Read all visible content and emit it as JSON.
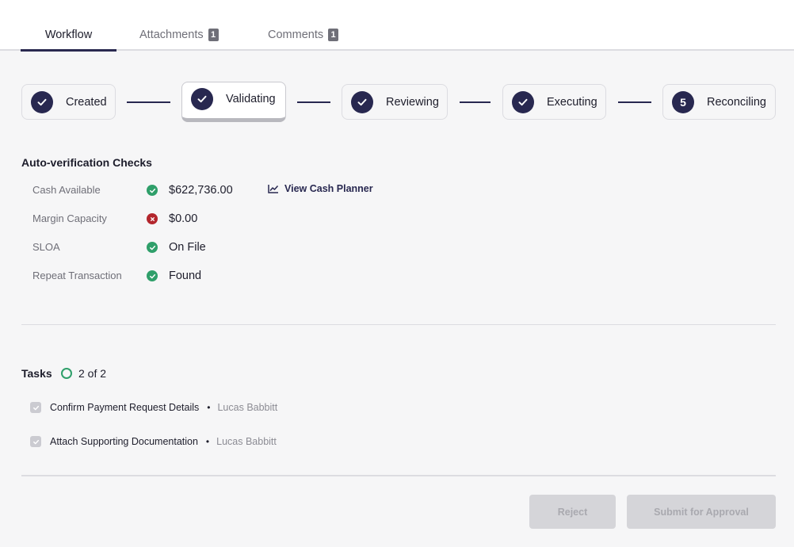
{
  "tabs": [
    {
      "label": "Workflow",
      "count": ""
    },
    {
      "label": "Attachments",
      "count": "1"
    },
    {
      "label": "Comments",
      "count": "1"
    }
  ],
  "steps": [
    {
      "label": "Created",
      "marker": "check"
    },
    {
      "label": "Validating",
      "marker": "check"
    },
    {
      "label": "Reviewing",
      "marker": "check"
    },
    {
      "label": "Executing",
      "marker": "check"
    },
    {
      "label": "Reconciling",
      "marker": "5"
    }
  ],
  "verification": {
    "title": "Auto-verification Checks",
    "checks": [
      {
        "label": "Cash Available",
        "status": "pass",
        "value": "$622,736.00"
      },
      {
        "label": "Margin Capacity",
        "status": "fail",
        "value": "$0.00"
      },
      {
        "label": "SLOA",
        "status": "pass",
        "value": "On File"
      },
      {
        "label": "Repeat Transaction",
        "status": "pass",
        "value": "Found"
      }
    ],
    "link_label": "View Cash Planner",
    "link_icon": "line-chart-icon"
  },
  "tasks": {
    "title": "Tasks",
    "count_label": "2 of 2",
    "items": [
      {
        "label": "Confirm Payment Request Details",
        "assignee": "Lucas Babbitt",
        "checked": true
      },
      {
        "label": "Attach Supporting Documentation",
        "assignee": "Lucas Babbitt",
        "checked": true
      }
    ]
  },
  "buttons": {
    "reject_label": "Reject",
    "submit_label": "Submit for Approval"
  },
  "colors": {
    "accent": "#282850",
    "success": "#2f9f6a",
    "error": "#b3262d",
    "disabled_button": "#d5d5d9"
  }
}
